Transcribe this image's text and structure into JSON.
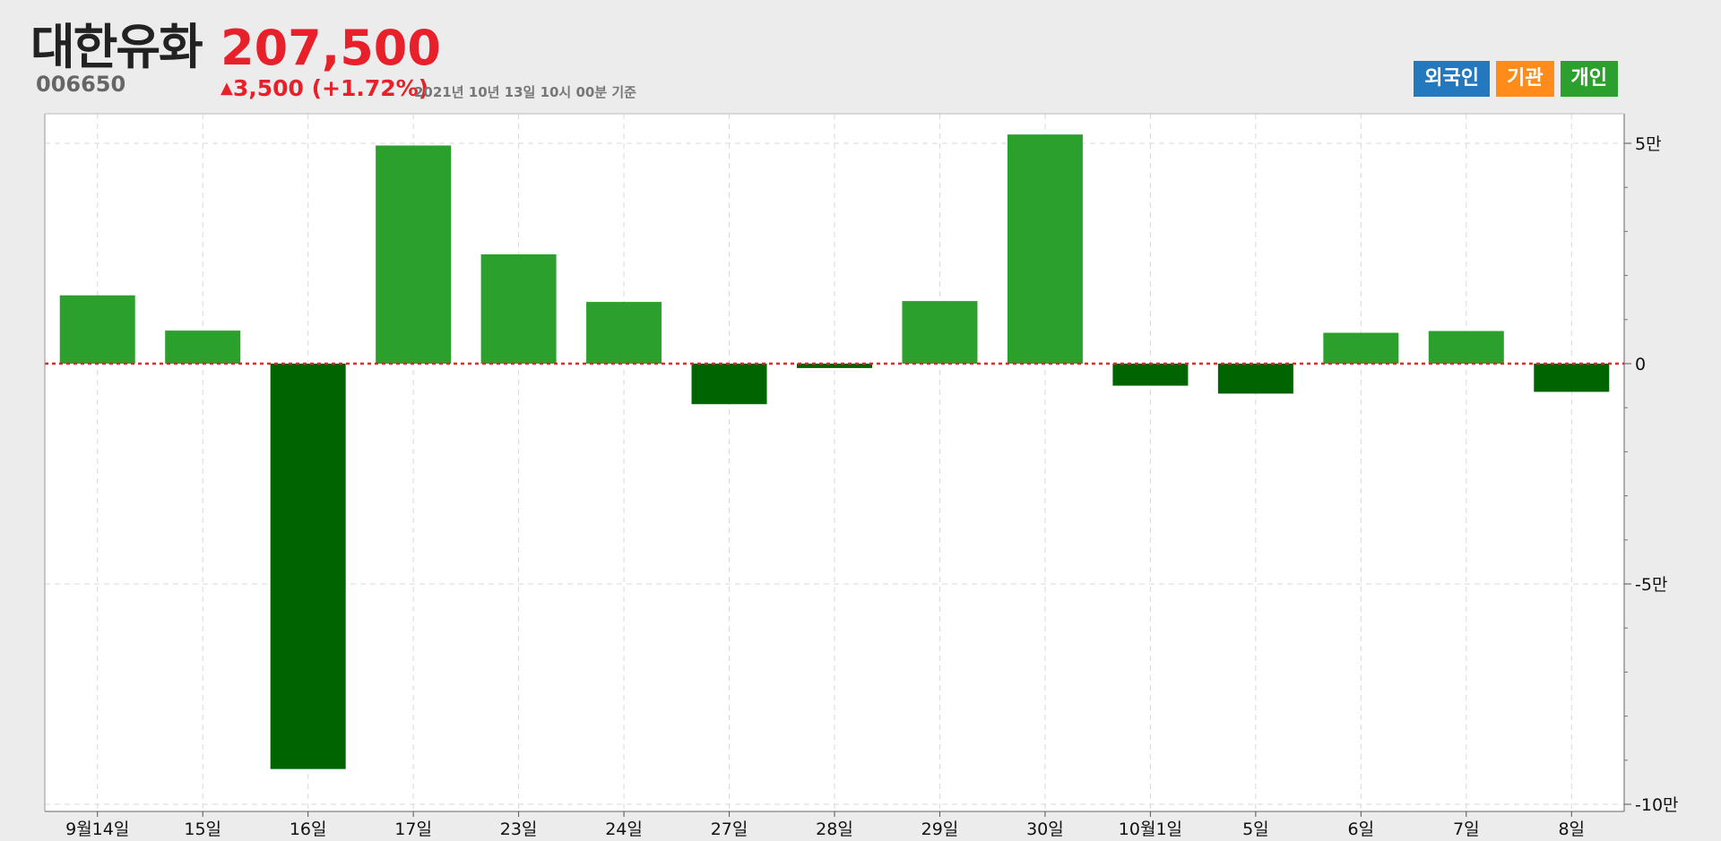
{
  "stock": {
    "name": "대한유화",
    "code": "006650",
    "price": "207,500",
    "change_arrow": "▲",
    "change": "3,500 (+1.72%)",
    "as_of": "2021년 10년 13일 10시 00분 기준"
  },
  "legend": {
    "foreign": {
      "label": "외국인",
      "color": "#2478bd"
    },
    "institution": {
      "label": "기관",
      "color": "#ff8c1a"
    },
    "individual": {
      "label": "개인",
      "color": "#2ca02c"
    }
  },
  "chart_data": {
    "type": "bar",
    "categories": [
      "9월14일",
      "15일",
      "16일",
      "17일",
      "23일",
      "24일",
      "27일",
      "28일",
      "29일",
      "30일",
      "10월1일",
      "5일",
      "6일",
      "7일",
      "8일"
    ],
    "series": [
      {
        "name": "개인",
        "values": [
          15500,
          7500,
          -92000,
          49500,
          24800,
          14000,
          -9200,
          -1000,
          14200,
          52000,
          -5000,
          -6800,
          7000,
          7400,
          -6400
        ],
        "positive_color": "#2ca02c",
        "negative_color": "#006400"
      }
    ],
    "ylim": [
      -100000,
      57000
    ],
    "yticks": [
      50000,
      0,
      -50000,
      -100000
    ],
    "ytick_labels": [
      "5만",
      "0",
      "-5만",
      "-10만"
    ],
    "zero_line_color": "#e8202a",
    "grid": true,
    "xlabel": "",
    "ylabel": ""
  }
}
